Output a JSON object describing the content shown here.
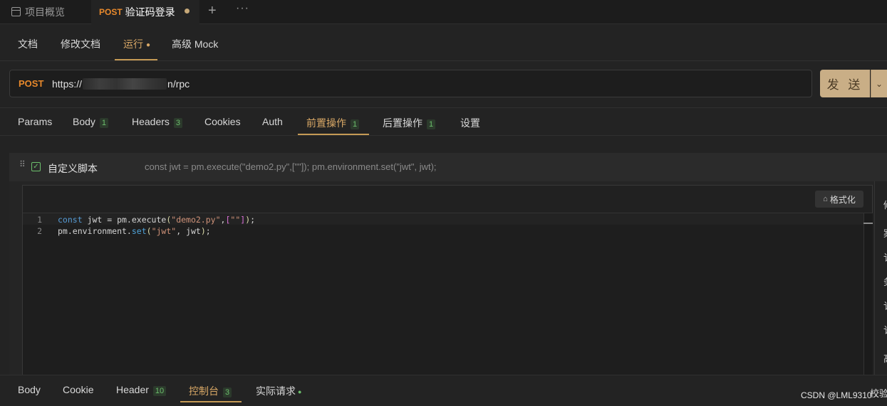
{
  "tabs": {
    "project_overview": "项目概览",
    "active_method": "POST",
    "active_title": "验证码登录",
    "new_tab": "+",
    "more": "···"
  },
  "subnav": {
    "items": [
      "文档",
      "修改文档",
      "运行",
      "高级 Mock"
    ],
    "active_index": 2
  },
  "request": {
    "method": "POST",
    "url_prefix": "https://",
    "url_suffix": "n/rpc",
    "send_label": "发 送",
    "send_dropdown": "⌄"
  },
  "request_tabs": {
    "params": "Params",
    "body": "Body",
    "body_count": "1",
    "headers": "Headers",
    "headers_count": "3",
    "cookies": "Cookies",
    "auth": "Auth",
    "pre_ops": "前置操作",
    "pre_ops_count": "1",
    "post_ops": "后置操作",
    "post_ops_count": "1",
    "settings": "设置"
  },
  "script": {
    "checkmark": "✓",
    "name": "自定义脚本",
    "preview": "const jwt = pm.execute(\"demo2.py\",[\"\"]); pm.environment.set(\"jwt\", jwt);",
    "format_label": "格式化",
    "line_numbers": [
      "1",
      "2"
    ]
  },
  "bottom_tabs": {
    "body": "Body",
    "cookie": "Cookie",
    "header": "Header",
    "header_count": "10",
    "console": "控制台",
    "console_count": "3",
    "actual_request": "实际请求",
    "validate": "校验"
  },
  "right_panel_chars": [
    "修",
    "案",
    "讠",
    "务",
    "讠",
    "讠",
    "高"
  ],
  "watermark": "CSDN @LML9310",
  "colors": {
    "accent": "#d9a866",
    "method": "#e8892c",
    "badge_green": "#6cbf6c",
    "send_button": "#c9ae86"
  }
}
